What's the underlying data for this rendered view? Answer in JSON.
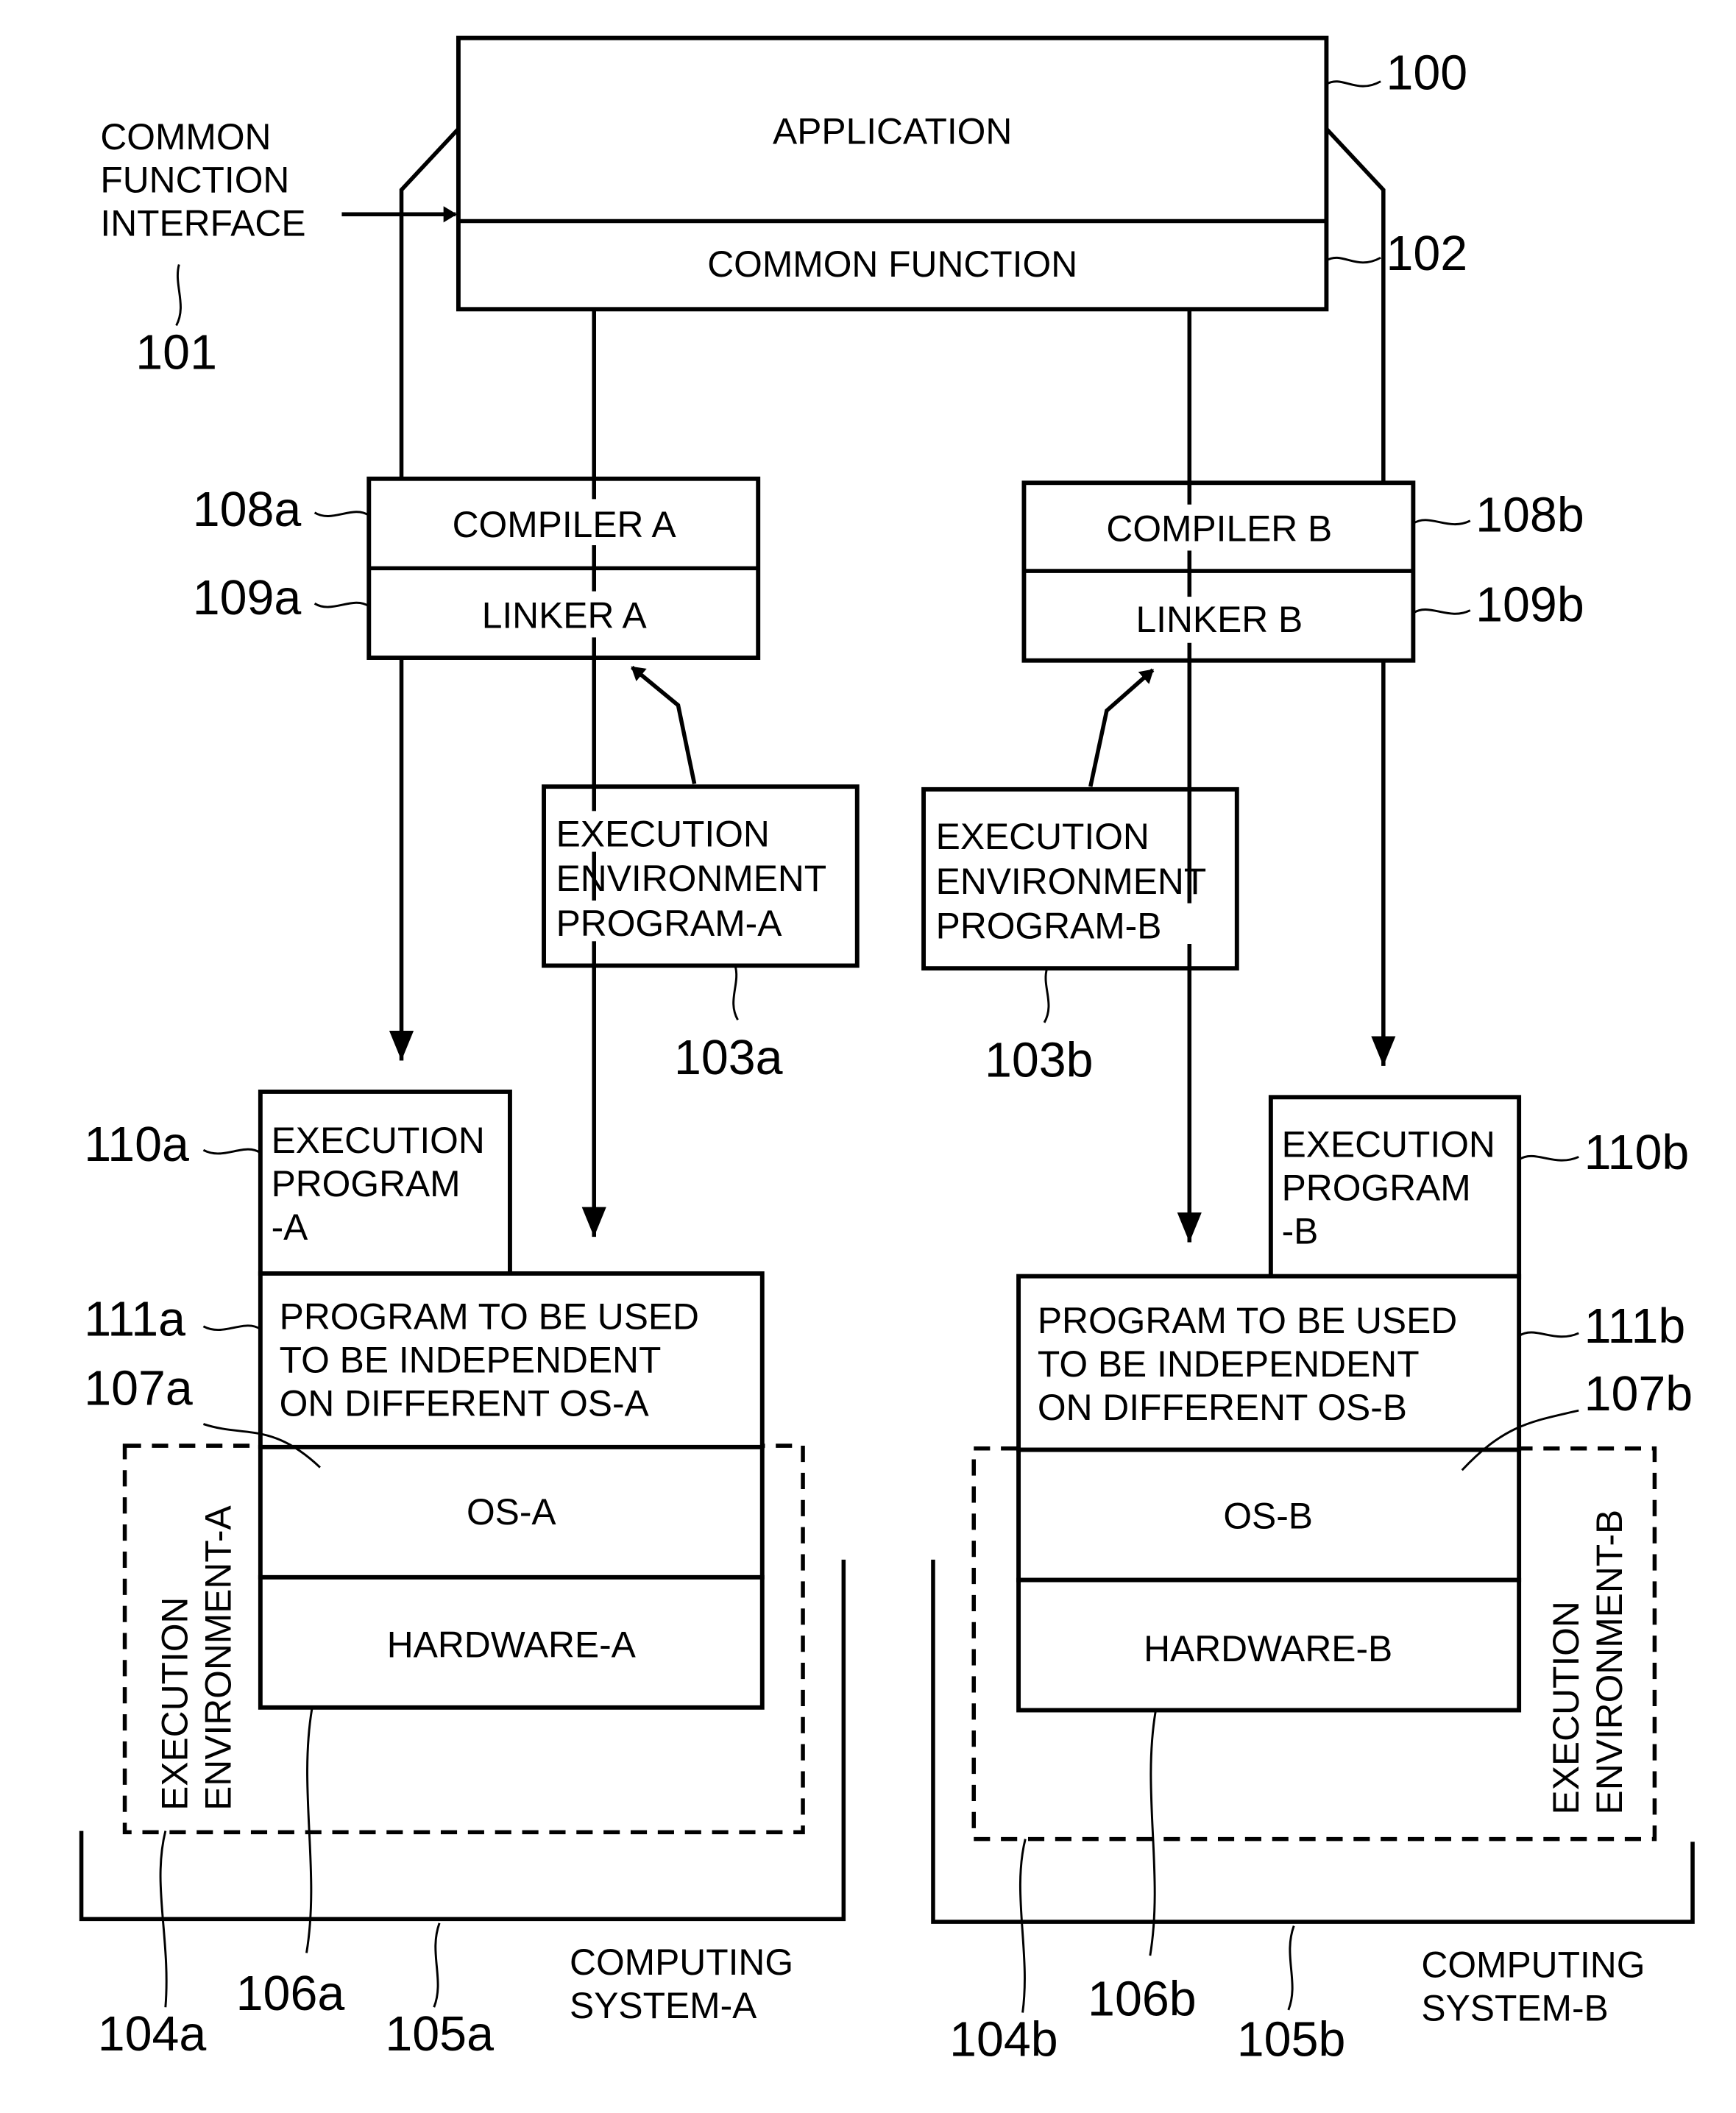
{
  "figure": {
    "colors": {
      "ink": "#000000",
      "paper": "#ffffff"
    },
    "top": {
      "application": {
        "label": "APPLICATION",
        "ref": "100"
      },
      "common_function": {
        "label": "COMMON FUNCTION",
        "ref": "102"
      },
      "interface": {
        "lines": [
          "COMMON",
          "FUNCTION",
          "INTERFACE"
        ],
        "ref": "101"
      }
    },
    "side_a": {
      "compiler": {
        "label": "COMPILER A",
        "ref": "108a"
      },
      "linker": {
        "label": "LINKER A",
        "ref": "109a"
      },
      "env_program": {
        "lines": [
          "EXECUTION",
          "ENVIRONMENT",
          "PROGRAM-A"
        ],
        "ref": "103a"
      },
      "exec_program": {
        "lines": [
          "EXECUTION",
          "PROGRAM",
          "-A"
        ],
        "ref": "110a"
      },
      "independent_program": {
        "lines": [
          "PROGRAM TO BE USED",
          "TO BE INDEPENDENT",
          "ON DIFFERENT OS-A"
        ],
        "ref": "111a"
      },
      "os": {
        "label": "OS-A",
        "ref": "107a"
      },
      "hardware": {
        "label": "HARDWARE-A",
        "ref": "106a"
      },
      "execution_environment": {
        "lines": [
          "EXECUTION",
          "ENVIRONMENT-A"
        ],
        "ref": "104a"
      },
      "computing_system": {
        "lines": [
          "COMPUTING",
          "SYSTEM-A"
        ],
        "ref": "105a"
      }
    },
    "side_b": {
      "compiler": {
        "label": "COMPILER B",
        "ref": "108b"
      },
      "linker": {
        "label": "LINKER B",
        "ref": "109b"
      },
      "env_program": {
        "lines": [
          "EXECUTION",
          "ENVIRONMENT",
          "PROGRAM-B"
        ],
        "ref": "103b"
      },
      "exec_program": {
        "lines": [
          "EXECUTION",
          "PROGRAM",
          "-B"
        ],
        "ref": "110b"
      },
      "independent_program": {
        "lines": [
          "PROGRAM TO BE USED",
          "TO BE INDEPENDENT",
          "ON DIFFERENT OS-B"
        ],
        "ref": "111b"
      },
      "os": {
        "label": "OS-B",
        "ref": "107b"
      },
      "hardware": {
        "label": "HARDWARE-B",
        "ref": "106b"
      },
      "execution_environment": {
        "lines": [
          "EXECUTION",
          "ENVIRONMENT-B"
        ],
        "ref": "104b"
      },
      "computing_system": {
        "lines": [
          "COMPUTING",
          "SYSTEM-B"
        ],
        "ref": "105b"
      }
    }
  }
}
